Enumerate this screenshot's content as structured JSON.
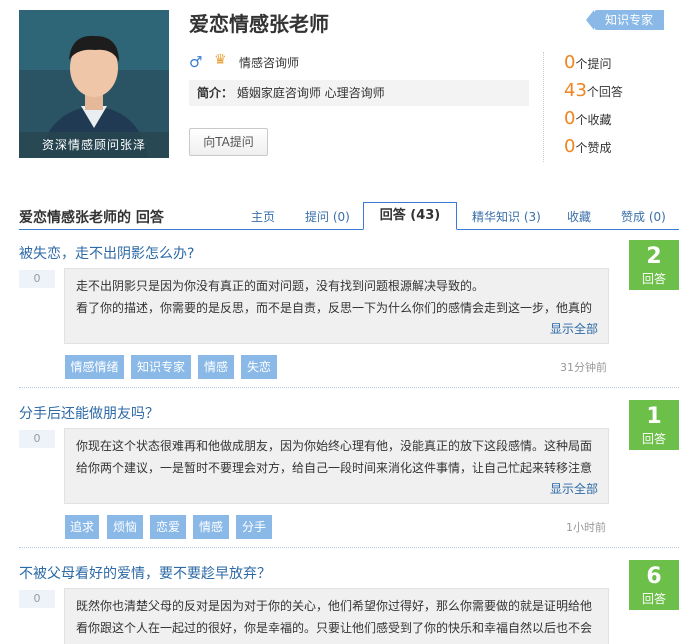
{
  "profile": {
    "name": "爱恋情感张老师",
    "badge": "知识专家",
    "gender_icon": "male-icon",
    "level_icon": "crown-icon",
    "title": "情感咨询师",
    "intro_label": "简介：",
    "intro": "婚姻家庭咨询师  心理咨询师",
    "avatar_caption": "资深情感顾问张泽",
    "ask_button": "向TA提问",
    "stats": [
      {
        "num": "0",
        "label": "个提问"
      },
      {
        "num": "43",
        "label": "个回答"
      },
      {
        "num": "0",
        "label": "个收藏"
      },
      {
        "num": "0",
        "label": "个赞成"
      }
    ]
  },
  "section": {
    "title": "爱恋情感张老师的  回答"
  },
  "tabs": [
    {
      "label": "主页"
    },
    {
      "label": "提问 (0)"
    },
    {
      "label": "回答 (43)"
    },
    {
      "label": "精华知识 (3)"
    },
    {
      "label": "收藏"
    },
    {
      "label": "赞成 (0)"
    }
  ],
  "questions": [
    {
      "title": "被失恋，走不出阴影怎么办?",
      "votes": "0",
      "answer_lines": [
        "走不出阴影只是因为你没有真正的面对问题，没有找到问题根源解决导致的。",
        "看了你的描述，你需要的是反思，而不是自责，反思一下为什么你们的感情会走到这一步，他真的"
      ],
      "show_all": "显示全部",
      "tags": [
        "情感情绪",
        "知识专家",
        "情感",
        "失恋"
      ],
      "time": "31分钟前",
      "count": "2",
      "count_label": "回答"
    },
    {
      "title": "分手后还能做朋友吗？",
      "votes": "0",
      "answer_lines": [
        "你现在这个状态很难再和他做成朋友，因为你始终心理有他，没能真正的放下这段感情。这种局面",
        "给你两个建议，一是暂时不要理会对方，给自己一段时间来消化这件事情，让自己忙起来转移注意"
      ],
      "show_all": "显示全部",
      "tags": [
        "追求",
        "烦恼",
        "恋爱",
        "情感",
        "分手"
      ],
      "time": "1小时前",
      "count": "1",
      "count_label": "回答"
    },
    {
      "title": "不被父母看好的爱情，要不要趁早放弃？",
      "votes": "0",
      "answer_lines": [
        "既然你也清楚父母的反对是因为对于你的关心，他们希望你过得好，那么你需要做的就是证明给他",
        "看你跟这个人在一起过的很好，你是幸福的。只要让他们感受到了你的快乐和幸福自然以后也不会"
      ],
      "show_all": "",
      "tags": [],
      "time": "",
      "count": "6",
      "count_label": "回答"
    }
  ],
  "colors": {
    "accent_blue": "#3a7bd5",
    "tag_blue": "#8ab9e8",
    "count_green": "#6cc04a",
    "stat_orange": "#f0841f"
  }
}
